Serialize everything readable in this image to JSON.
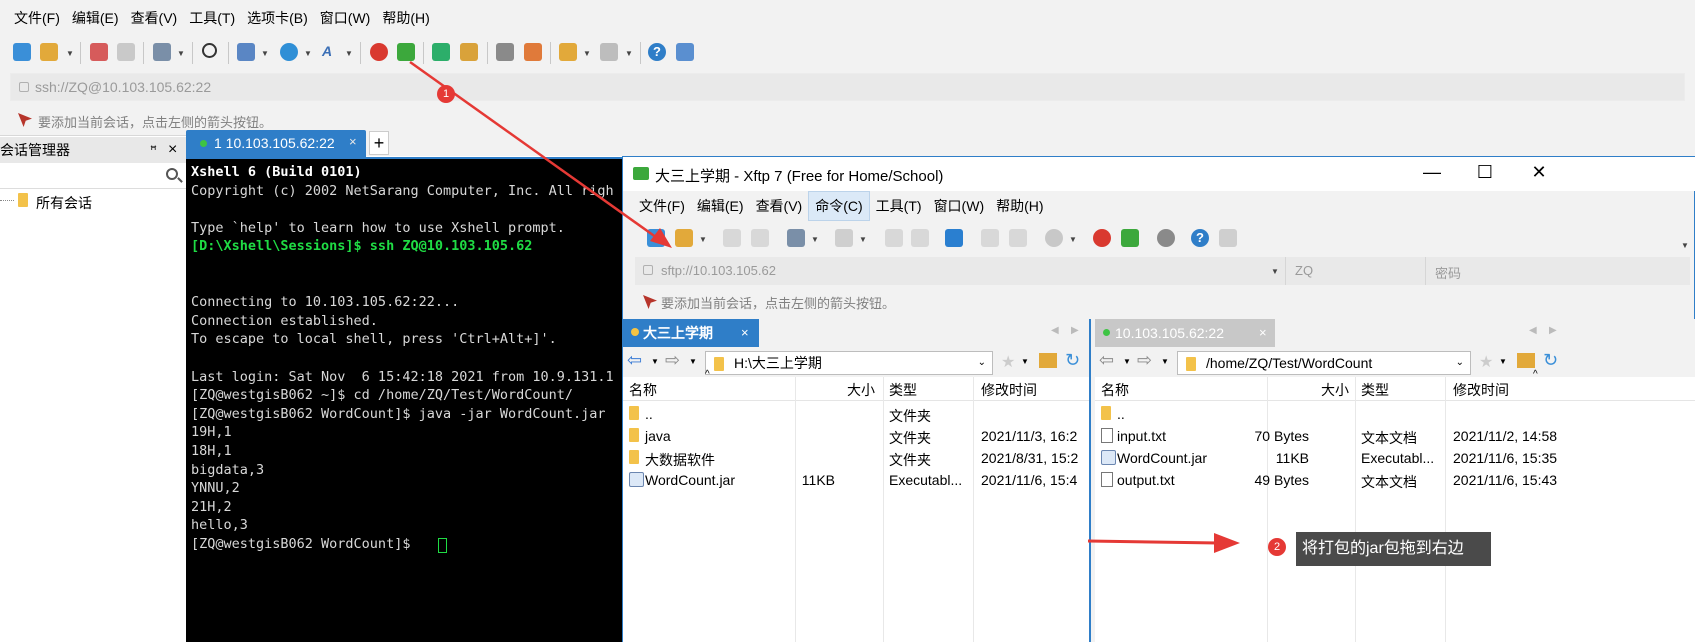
{
  "xshell": {
    "menu": [
      "文件(F)",
      "编辑(E)",
      "查看(V)",
      "工具(T)",
      "选项卡(B)",
      "窗口(W)",
      "帮助(H)"
    ],
    "address": "ssh://ZQ@10.103.105.62:22",
    "hint": "要添加当前会话，点击左侧的箭头按钮。",
    "session_panel": {
      "title": "会话管理器",
      "pin": " ",
      "close": "×",
      "root": "所有会话"
    },
    "tab": {
      "label": "1 10.103.105.62:22",
      "close": "×",
      "add": "+"
    },
    "terminal_lines": [
      {
        "text": "Xshell 6 (Build 0101)",
        "style": "w"
      },
      {
        "text": "Copyright (c) 2002 NetSarang Computer, Inc. All righ",
        "style": ""
      },
      {
        "text": "",
        "style": ""
      },
      {
        "text": "Type `help' to learn how to use Xshell prompt.",
        "style": ""
      },
      {
        "text": "[D:\\Xshell\\Sessions]$ ssh ZQ@10.103.105.62",
        "style": "g"
      },
      {
        "text": "",
        "style": ""
      },
      {
        "text": "",
        "style": ""
      },
      {
        "text": "Connecting to 10.103.105.62:22...",
        "style": ""
      },
      {
        "text": "Connection established.",
        "style": ""
      },
      {
        "text": "To escape to local shell, press 'Ctrl+Alt+]'.",
        "style": ""
      },
      {
        "text": "",
        "style": ""
      },
      {
        "text": "Last login: Sat Nov  6 15:42:18 2021 from 10.9.131.1",
        "style": ""
      },
      {
        "text": "[ZQ@westgisB062 ~]$ cd /home/ZQ/Test/WordCount/",
        "style": ""
      },
      {
        "text": "[ZQ@westgisB062 WordCount]$ java -jar WordCount.jar",
        "style": ""
      },
      {
        "text": "19H,1",
        "style": ""
      },
      {
        "text": "18H,1",
        "style": ""
      },
      {
        "text": "bigdata,3",
        "style": ""
      },
      {
        "text": "YNNU,2",
        "style": ""
      },
      {
        "text": "21H,2",
        "style": ""
      },
      {
        "text": "hello,3",
        "style": ""
      },
      {
        "text": "[ZQ@westgisB062 WordCount]$ ",
        "style": ""
      }
    ]
  },
  "xftp": {
    "title": "大三上学期 - Xftp 7 (Free for Home/School)",
    "win_min": "—",
    "win_max": "☐",
    "win_close": "✕",
    "menu": [
      "文件(F)",
      "编辑(E)",
      "查看(V)",
      "命令(C)",
      "工具(T)",
      "窗口(W)",
      "帮助(H)"
    ],
    "address": "sftp://10.103.105.62",
    "user_placeholder": "ZQ",
    "password_placeholder": "密码",
    "hint": "要添加当前会话，点击左侧的箭头按钮。",
    "local": {
      "tab": "大三上学期",
      "path": "H:\\大三上学期",
      "headers": [
        "名称",
        "大小",
        "类型",
        "修改时间"
      ],
      "rows": [
        {
          "name": "..",
          "size": "",
          "type": "文件夹",
          "modified": "",
          "icon": "folder"
        },
        {
          "name": "java",
          "size": "",
          "type": "文件夹",
          "modified": "2021/11/3, 16:2",
          "icon": "folder"
        },
        {
          "name": "大数据软件",
          "size": "",
          "type": "文件夹",
          "modified": "2021/8/31, 15:2",
          "icon": "folder"
        },
        {
          "name": "WordCount.jar",
          "size": "11KB",
          "type": "Executabl...",
          "modified": "2021/11/6, 15:4",
          "icon": "jar"
        }
      ]
    },
    "remote": {
      "tab": "10.103.105.62:22",
      "path": "/home/ZQ/Test/WordCount",
      "headers": [
        "名称",
        "大小",
        "类型",
        "修改时间"
      ],
      "rows": [
        {
          "name": "..",
          "size": "",
          "type": "",
          "modified": "",
          "icon": "folder"
        },
        {
          "name": "input.txt",
          "size": "70 Bytes",
          "type": "文本文档",
          "modified": "2021/11/2, 14:58",
          "icon": "file"
        },
        {
          "name": "WordCount.jar",
          "size": "11KB",
          "type": "Executabl...",
          "modified": "2021/11/6, 15:35",
          "icon": "jar"
        },
        {
          "name": "output.txt",
          "size": "49 Bytes",
          "type": "文本文档",
          "modified": "2021/11/6, 15:43",
          "icon": "file"
        }
      ]
    }
  },
  "annotations": {
    "badge1": "1",
    "badge2": "2",
    "callout": "将打包的jar包拖到右边",
    "arrow_color": "#e53935"
  }
}
